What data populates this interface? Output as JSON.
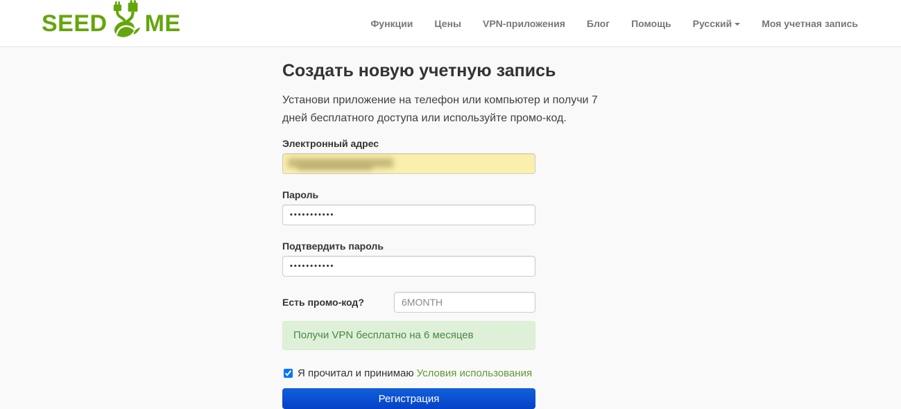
{
  "brand": {
    "name_left": "SEED",
    "name_right": "ME",
    "color": "#64a60c"
  },
  "nav": {
    "items": [
      {
        "label": "Функции"
      },
      {
        "label": "Цены"
      },
      {
        "label": "VPN-приложения"
      },
      {
        "label": "Блог"
      },
      {
        "label": "Помощь"
      },
      {
        "label": "Русский",
        "has_dropdown": true
      },
      {
        "label": "Моя учетная запись"
      }
    ]
  },
  "form": {
    "title": "Создать новую учетную запись",
    "subtitle": "Установи приложение на телефон или компьютер и получи 7 дней бесплатного доступа или используйте промо-код.",
    "email": {
      "label": "Электронный адрес",
      "redacted": true
    },
    "password": {
      "label": "Пароль",
      "masked_value": "•••••••••••"
    },
    "password_confirm": {
      "label": "Подтвердить пароль",
      "masked_value": "•••••••••••"
    },
    "promo": {
      "label": "Есть промо-код?",
      "value": "6MONTH"
    },
    "promo_message": "Получи VPN бесплатно на 6 месяцев",
    "terms": {
      "checked": true,
      "text": "Я прочитал и принимаю",
      "link_label": "Условия использования"
    },
    "submit_label": "Регистрация"
  },
  "colors": {
    "brand_green": "#64a60c",
    "link_green": "#5f9a32",
    "nav_gray": "#777777",
    "alert_bg": "#dff0d8",
    "alert_text": "#468847",
    "email_autofill_bg": "#faefad",
    "button_gradient_top": "#1160db",
    "button_gradient_bottom": "#0542c7",
    "page_bg": "#f9f9f9"
  }
}
